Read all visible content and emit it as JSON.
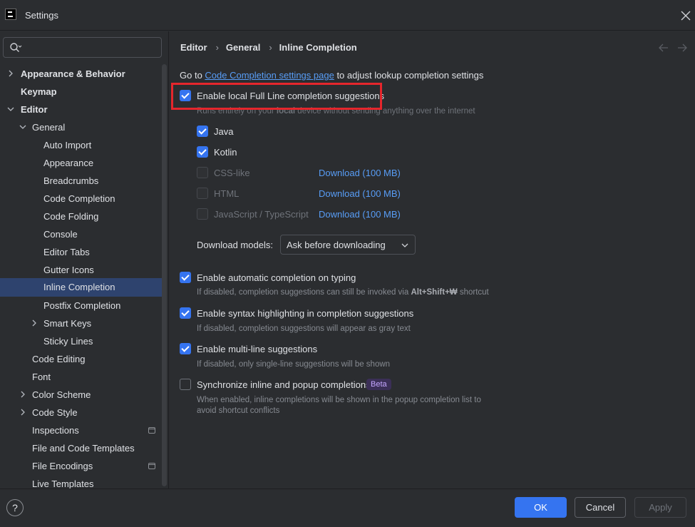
{
  "window": {
    "title": "Settings"
  },
  "sidebar": {
    "search_placeholder": "",
    "items": [
      {
        "label": "Appearance & Behavior",
        "bold": true,
        "chevron": "right"
      },
      {
        "label": "Keymap",
        "bold": true
      },
      {
        "label": "Editor",
        "bold": true,
        "chevron": "down"
      },
      {
        "label": "General",
        "chevron": "down"
      },
      {
        "label": "Auto Import"
      },
      {
        "label": "Appearance"
      },
      {
        "label": "Breadcrumbs"
      },
      {
        "label": "Code Completion"
      },
      {
        "label": "Code Folding"
      },
      {
        "label": "Console"
      },
      {
        "label": "Editor Tabs"
      },
      {
        "label": "Gutter Icons"
      },
      {
        "label": "Inline Completion",
        "selected": true
      },
      {
        "label": "Postfix Completion"
      },
      {
        "label": "Smart Keys",
        "chevron": "right"
      },
      {
        "label": "Sticky Lines"
      },
      {
        "label": "Code Editing"
      },
      {
        "label": "Font"
      },
      {
        "label": "Color Scheme",
        "chevron": "right"
      },
      {
        "label": "Code Style",
        "chevron": "right"
      },
      {
        "label": "Inspections",
        "icon": "settings-scope-icon"
      },
      {
        "label": "File and Code Templates"
      },
      {
        "label": "File Encodings",
        "icon": "settings-scope-icon"
      },
      {
        "label": "Live Templates"
      }
    ]
  },
  "breadcrumb": [
    "Editor",
    "General",
    "Inline Completion"
  ],
  "content": {
    "goto_prefix": "Go to",
    "goto_link": "Code Completion settings page",
    "goto_suffix": "to adjust lookup completion settings",
    "full_line": {
      "label": "Enable local Full Line completion suggestions",
      "checked": true,
      "hint_pre": "Runs entirely on your",
      "hint_em": "local",
      "hint_post": "device without sending anything over the internet"
    },
    "languages": [
      {
        "label": "Java",
        "checked": true,
        "enabled": true,
        "download": ""
      },
      {
        "label": "Kotlin",
        "checked": true,
        "enabled": true,
        "download": ""
      },
      {
        "label": "CSS-like",
        "checked": false,
        "enabled": false,
        "download": "Download (100 MB)"
      },
      {
        "label": "HTML",
        "checked": false,
        "enabled": false,
        "download": "Download (100 MB)"
      },
      {
        "label": "JavaScript / TypeScript",
        "checked": false,
        "enabled": false,
        "download": "Download (100 MB)"
      }
    ],
    "download_models": {
      "label": "Download models:",
      "value": "Ask before downloading"
    },
    "options": [
      {
        "label": "Enable automatic completion on typing",
        "checked": true,
        "hint_pre": "If disabled, completion suggestions can still be invoked via",
        "hint_key": "Alt+Shift+₩",
        "hint_post": "shortcut"
      },
      {
        "label": "Enable syntax highlighting in completion suggestions",
        "checked": true,
        "hint": "If disabled, completion suggestions will appear as gray text"
      },
      {
        "label": "Enable multi-line suggestions",
        "checked": true,
        "hint": "If disabled, only single-line suggestions will be shown"
      },
      {
        "label": "Synchronize inline and popup completions",
        "checked": false,
        "badge": "Beta",
        "hint_line1": "When enabled, inline completions will be shown in the popup completion list to",
        "hint_line2": "avoid shortcut conflicts"
      }
    ]
  },
  "footer": {
    "help": "?",
    "ok": "OK",
    "cancel": "Cancel",
    "apply": "Apply"
  },
  "colors": {
    "accent": "#3574f0",
    "link": "#589df6",
    "highlight_box": "#e5262c",
    "selection": "#2e436e"
  }
}
